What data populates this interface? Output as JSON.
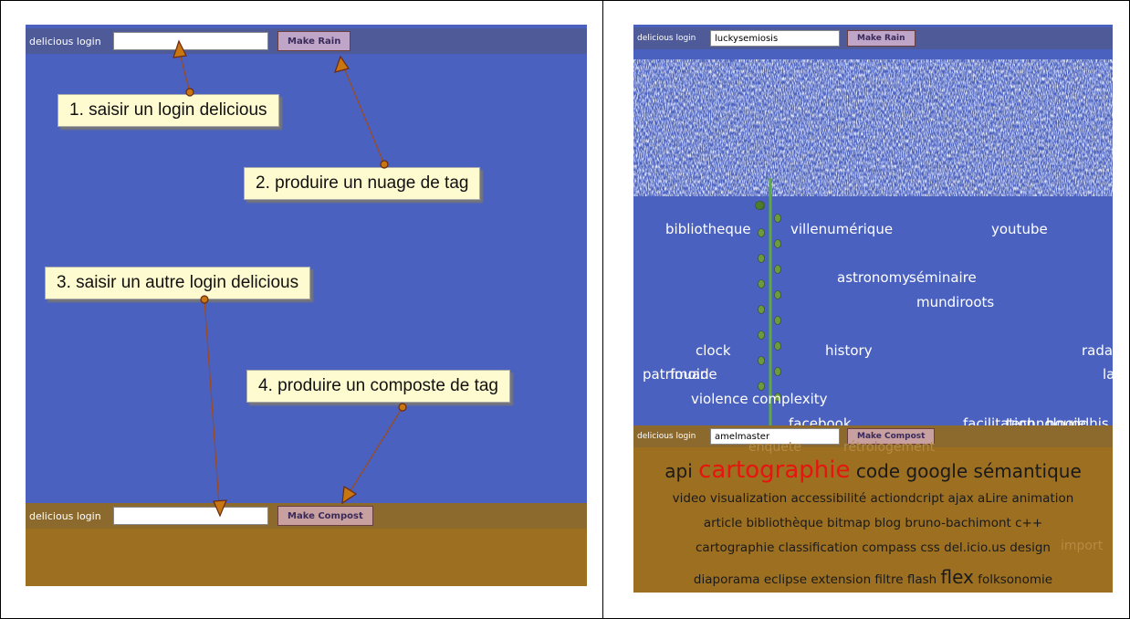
{
  "left_panel": {
    "top_bar": {
      "label": "delicious login",
      "input_value": "",
      "button": "Make Rain"
    },
    "bottom_bar": {
      "label": "delicious login",
      "input_value": "",
      "button": "Make Compost"
    },
    "callouts": [
      "1. saisir un login delicious",
      "2. produire un nuage de tag",
      "3. saisir un autre login delicious",
      "4. produire un composte de tag"
    ]
  },
  "right_panel": {
    "top_bar": {
      "label": "delicious login",
      "input_value": "luckysemiosis",
      "button": "Make Rain"
    },
    "bottom_bar": {
      "label": "delicious login",
      "input_value": "amelmaster",
      "button": "Make Compost"
    },
    "rain_tags": [
      "bibliotheque",
      "villenumérique",
      "youtube",
      "astronomy",
      "séminaire",
      "mundiroots",
      "clock",
      "history",
      "rada",
      "patrimoine",
      "fouad",
      "la",
      "violence",
      "complexity",
      "facebook",
      "facilitation",
      "technologie",
      "bouddhis"
    ],
    "compost_lines": [
      [
        "api",
        "cartographie",
        "code",
        "google",
        "sémantique"
      ],
      [
        "video",
        "visualization",
        "accessibilité",
        "actiondcript",
        "ajax",
        "aLire",
        "animation"
      ],
      [
        "article",
        "bibliothèque",
        "bitmap",
        "blog",
        "bruno-bachimont",
        "c++"
      ],
      [
        "cartographie",
        "classification",
        "compass",
        "css",
        "del.icio.us",
        "design"
      ],
      [
        "diaporama",
        "eclipse",
        "extension",
        "filtre",
        "flash",
        "flex",
        "folksonomie"
      ]
    ],
    "compost_faded": [
      "enquete",
      "rétrologement",
      "import"
    ]
  },
  "colors": {
    "blue_field": "#4a61bf",
    "top_bar": "#4f5a98",
    "compost_bar": "#8c6a2e",
    "compost_field": "#9c6f21",
    "highlight_tag": "#e8140f",
    "arrow": "#9e4a1a"
  }
}
